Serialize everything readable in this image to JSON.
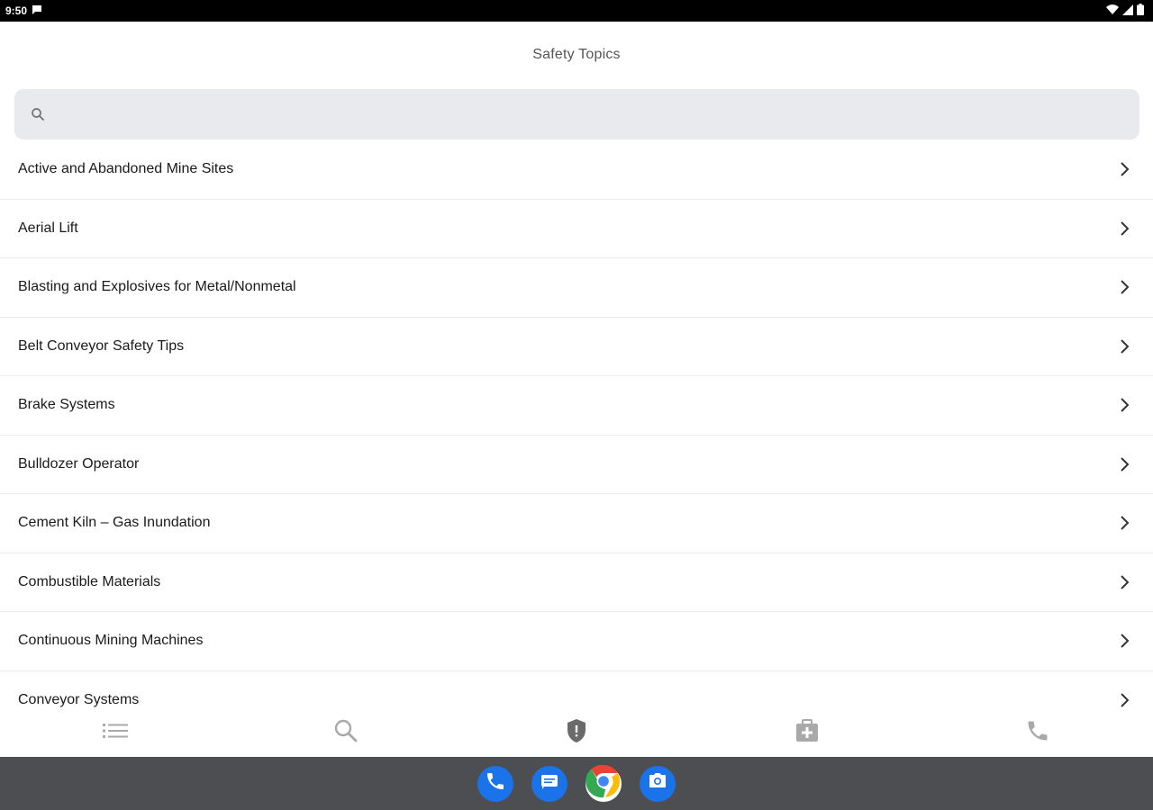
{
  "status_bar": {
    "time": "9:50"
  },
  "header": {
    "title": "Safety Topics"
  },
  "search": {
    "value": "",
    "placeholder": ""
  },
  "topics": [
    {
      "label": "Active and Abandoned Mine Sites"
    },
    {
      "label": "Aerial Lift"
    },
    {
      "label": "Blasting and Explosives for Metal/Nonmetal"
    },
    {
      "label": "Belt Conveyor Safety Tips"
    },
    {
      "label": "Brake Systems"
    },
    {
      "label": "Bulldozer Operator"
    },
    {
      "label": "Cement Kiln – Gas Inundation"
    },
    {
      "label": "Combustible Materials"
    },
    {
      "label": "Continuous Mining Machines"
    },
    {
      "label": "Conveyor Systems"
    }
  ],
  "bottom_nav": {
    "items": [
      {
        "icon": "list-icon",
        "active": false
      },
      {
        "icon": "search-icon",
        "active": false
      },
      {
        "icon": "shield-icon",
        "active": true
      },
      {
        "icon": "first-aid-kit-icon",
        "active": false
      },
      {
        "icon": "phone-icon",
        "active": false
      }
    ]
  },
  "dock": {
    "apps": [
      {
        "icon": "phone-app-icon",
        "color": "#1a73e8"
      },
      {
        "icon": "messages-app-icon",
        "color": "#1a73e8"
      },
      {
        "icon": "chrome-app-icon",
        "color": "#ffffff"
      },
      {
        "icon": "camera-app-icon",
        "color": "#1a73e8"
      }
    ]
  },
  "colors": {
    "nav_inactive": "#a9a9a9",
    "nav_active": "#6b6b6b",
    "search_bg": "#e9eaed",
    "dock_bg": "#4d4e51"
  }
}
